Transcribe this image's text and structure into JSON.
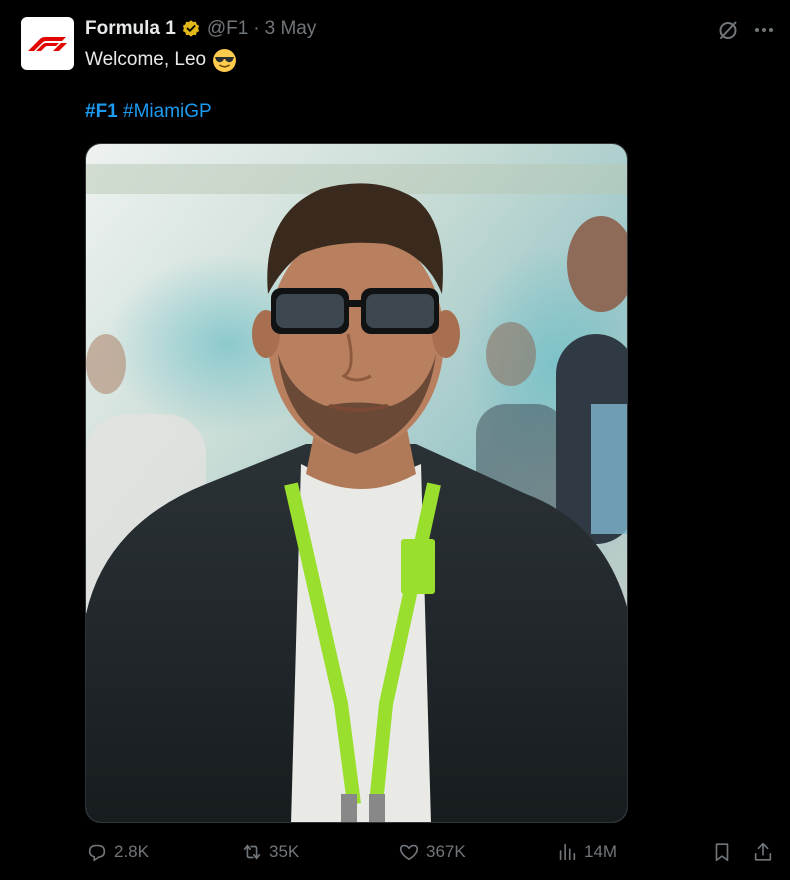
{
  "tweet": {
    "author": {
      "name": "Formula 1",
      "handle": "@F1",
      "separator": "·",
      "date": "3 May",
      "verified": true,
      "avatar_icon": "f1-logo-icon",
      "brand_color": "#e10600"
    },
    "text": "Welcome, Leo",
    "emoji": "smiling-face-with-sunglasses",
    "hashtags": [
      {
        "text": "#F1",
        "bold": true
      },
      {
        "text": "#MiamiGP",
        "bold": false
      }
    ],
    "media": {
      "type": "photo",
      "icon": "photo-placeholder"
    },
    "actions": {
      "replies": "2.8K",
      "reposts": "35K",
      "likes": "367K",
      "views": "14M"
    },
    "link_color": "#1d9bf0",
    "muted_color": "#71767b"
  }
}
